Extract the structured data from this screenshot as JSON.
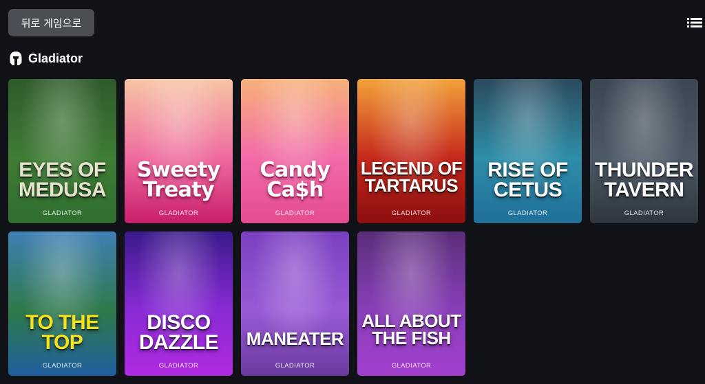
{
  "header": {
    "back_label": "뒤로 게임으로",
    "list_toggle_icon": "list-icon"
  },
  "provider": {
    "icon": "spartan-helmet-icon",
    "name": "Gladiator"
  },
  "games": [
    {
      "title": "EYES OF MEDUSA",
      "line1": "EYES OF",
      "line2": "MEDUSA",
      "provider": "GLADIATOR",
      "colors": [
        "#2e5a2a",
        "#3f7d35",
        "#2f6e2e"
      ],
      "text_color": "#e8e3cf",
      "style": "stone"
    },
    {
      "title": "Sweety Treaty",
      "line1": "Sweety",
      "line2": "Treaty",
      "provider": "GLADIATOR",
      "colors": [
        "#f7c6a4",
        "#ef6aa0",
        "#c81e6a"
      ],
      "text_color": "#ffffff",
      "style": "candy"
    },
    {
      "title": "Candy Ca$h",
      "line1": "Candy",
      "line2": "Ca$h",
      "provider": "GLADIATOR",
      "colors": [
        "#f7b27a",
        "#f26aa8",
        "#e54b8f"
      ],
      "text_color": "#ffffff",
      "style": "candy"
    },
    {
      "title": "LEGEND OF TARTARUS",
      "line1": "LEGEND OF",
      "line2": "TARTARUS",
      "provider": "GLADIATOR",
      "colors": [
        "#f2a23a",
        "#c5281c",
        "#8c0f0f"
      ],
      "text_color": "#ffffff",
      "style": "block"
    },
    {
      "title": "RISE OF CETUS",
      "line1": "RISE OF",
      "line2": "CETUS",
      "provider": "GLADIATOR",
      "colors": [
        "#2a4a5e",
        "#2f8ea8",
        "#1f6f9a"
      ],
      "text_color": "#ffffff",
      "style": "block"
    },
    {
      "title": "THUNDER TAVERN",
      "line1": "THUNDER",
      "line2": "TAVERN",
      "provider": "GLADIATOR",
      "colors": [
        "#3b4653",
        "#4d5a66",
        "#2e3640"
      ],
      "text_color": "#ffffff",
      "style": "block"
    },
    {
      "title": "TO THE TOP",
      "line1": "TO THE",
      "line2": "TOP",
      "provider": "GLADIATOR",
      "colors": [
        "#3f7fb5",
        "#2f7a4a",
        "#1f5fa0"
      ],
      "text_color": "#f5e21e",
      "style": "block"
    },
    {
      "title": "DISCO DAZZLE",
      "line1": "DISCO",
      "line2": "DAZZLE",
      "provider": "GLADIATOR",
      "colors": [
        "#3a1a8a",
        "#8a2bd6",
        "#b02ae0"
      ],
      "text_color": "#ffffff",
      "style": "block"
    },
    {
      "title": "MANEATER",
      "line1": "",
      "line2": "MANEATER",
      "provider": "GLADIATOR",
      "colors": [
        "#7a3fc0",
        "#9a5ad6",
        "#6a3a9e"
      ],
      "text_color": "#ffffff",
      "style": "block"
    },
    {
      "title": "ALL ABOUT THE FISH",
      "line1": "ALL ABOUT",
      "line2": "THE FISH",
      "provider": "GLADIATOR",
      "colors": [
        "#5a2e7a",
        "#8a3fb8",
        "#a33fd0"
      ],
      "text_color": "#ffffff",
      "style": "block"
    }
  ]
}
